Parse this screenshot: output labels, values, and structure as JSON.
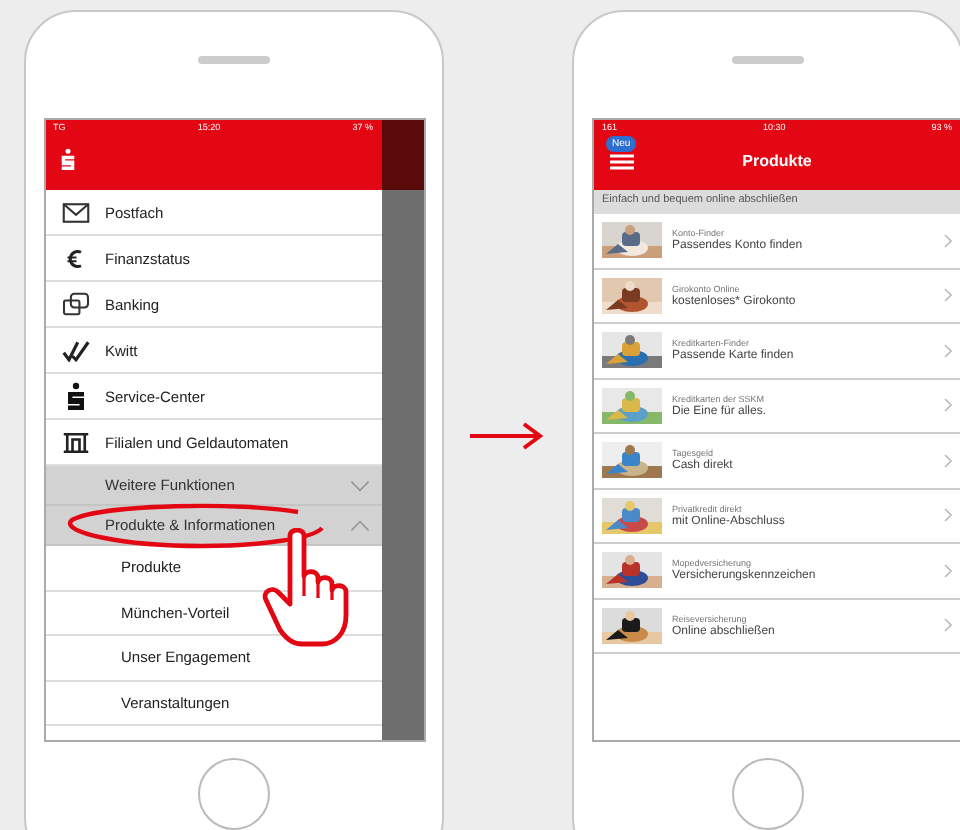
{
  "left_phone": {
    "status_bar": {
      "carrier": "TG",
      "time": "15:20",
      "battery": "37 %"
    },
    "menu": [
      {
        "label": "Postfach",
        "kind": "mail"
      },
      {
        "label": "Finanzstatus",
        "kind": "euro"
      },
      {
        "label": "Banking",
        "kind": "banking"
      },
      {
        "label": "Kwitt",
        "kind": "check"
      },
      {
        "label": "Service-Center",
        "kind": "logo"
      },
      {
        "label": "Filialen und Geldautomaten",
        "kind": "branch"
      }
    ],
    "sections": [
      {
        "label": "Weitere Funktionen",
        "expanded": false,
        "highlighted": false
      },
      {
        "label": "Produkte & Informationen",
        "expanded": true,
        "highlighted": true,
        "children": [
          {
            "label": "Produkte"
          },
          {
            "label": "München-Vorteil"
          },
          {
            "label": "Unser Engagement"
          },
          {
            "label": "Veranstaltungen"
          }
        ]
      }
    ]
  },
  "right_phone": {
    "status_bar": {
      "carrier": "161",
      "time": "10:30",
      "battery": "93 %"
    },
    "header": {
      "badge": "Neu",
      "title": "Produkte"
    },
    "subheader": "Einfach und bequem online abschließen",
    "products": [
      {
        "title": "Konto-Finder",
        "subtitle": "Passendes Konto finden"
      },
      {
        "title": "Girokonto Online",
        "subtitle": "kostenloses* Girokonto"
      },
      {
        "title": "Kreditkarten-Finder",
        "subtitle": "Passende Karte finden"
      },
      {
        "title": "Kreditkarten der SSKM",
        "subtitle": "Die Eine für alles."
      },
      {
        "title": "Tagesgeld",
        "subtitle": "Cash direkt"
      },
      {
        "title": "Privatkredit direkt",
        "subtitle": "mit Online-Abschluss"
      },
      {
        "title": "Mopedversicherung",
        "subtitle": "Versicherungskennzeichen"
      },
      {
        "title": "Reiseversicherung",
        "subtitle": "Online abschließen"
      }
    ]
  }
}
